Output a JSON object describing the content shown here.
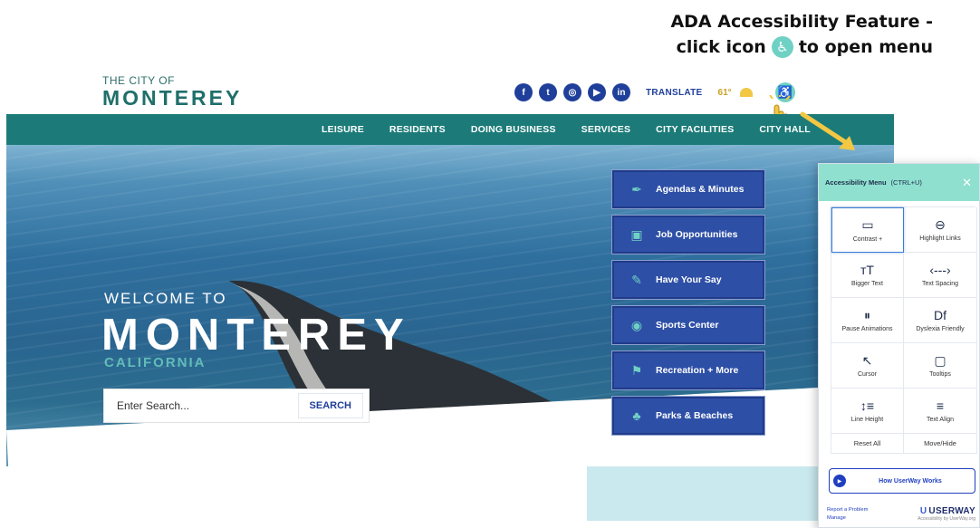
{
  "callout": {
    "line1": "ADA Accessibility Feature -",
    "line2_pre": "click icon",
    "line2_post": "to open menu"
  },
  "header": {
    "logo_small": "THE CITY OF",
    "logo_big": "MONTEREY",
    "social": [
      "f",
      "t",
      "ig",
      "yt",
      "in"
    ],
    "translate": "TRANSLATE",
    "temperature": "61°"
  },
  "nav": {
    "items": [
      "LEISURE",
      "RESIDENTS",
      "DOING BUSINESS",
      "SERVICES",
      "CITY FACILITIES",
      "CITY HALL"
    ]
  },
  "hero": {
    "welcome": "WELCOME TO",
    "title": "MONTEREY",
    "subtitle": "CALIFORNIA",
    "search_placeholder": "Enter Search...",
    "search_button": "SEARCH"
  },
  "quick_links": [
    {
      "label": "Agendas & Minutes",
      "icon": "pen-icon",
      "glyph": "✒"
    },
    {
      "label": "Job Opportunities",
      "icon": "briefcase-icon",
      "glyph": "▣"
    },
    {
      "label": "Have Your Say",
      "icon": "comment-pencil-icon",
      "glyph": "✎"
    },
    {
      "label": "Sports Center",
      "icon": "sports-icon",
      "glyph": "◉"
    },
    {
      "label": "Recreation + More",
      "icon": "recreation-icon",
      "glyph": "⚑"
    },
    {
      "label": "Parks & Beaches",
      "icon": "palm-tree-icon",
      "glyph": "♣"
    }
  ],
  "accessibility_panel": {
    "title": "Accessibility Menu",
    "shortcut": "(CTRL+U)",
    "options": [
      {
        "label": "Contrast +",
        "glyph": "▭"
      },
      {
        "label": "Highlight Links",
        "glyph": "⊖"
      },
      {
        "label": "Bigger Text",
        "glyph": "ᴛT"
      },
      {
        "label": "Text Spacing",
        "glyph": "‹---›"
      },
      {
        "label": "Pause Animations",
        "glyph": "⏸"
      },
      {
        "label": "Dyslexia Friendly",
        "glyph": "Df"
      },
      {
        "label": "Cursor",
        "glyph": "↖"
      },
      {
        "label": "Tooltips",
        "glyph": "▢"
      },
      {
        "label": "Line Height",
        "glyph": "↕≡"
      },
      {
        "label": "Text Align",
        "glyph": "≡"
      }
    ],
    "reset": "Reset All",
    "move_hide": "Move/Hide",
    "how_it_works": "How UserWay Works",
    "report": "Report a Problem",
    "manage": "Manage",
    "brand": "USERWAY",
    "brand_sub": "Accessibility by UserWay.org"
  }
}
